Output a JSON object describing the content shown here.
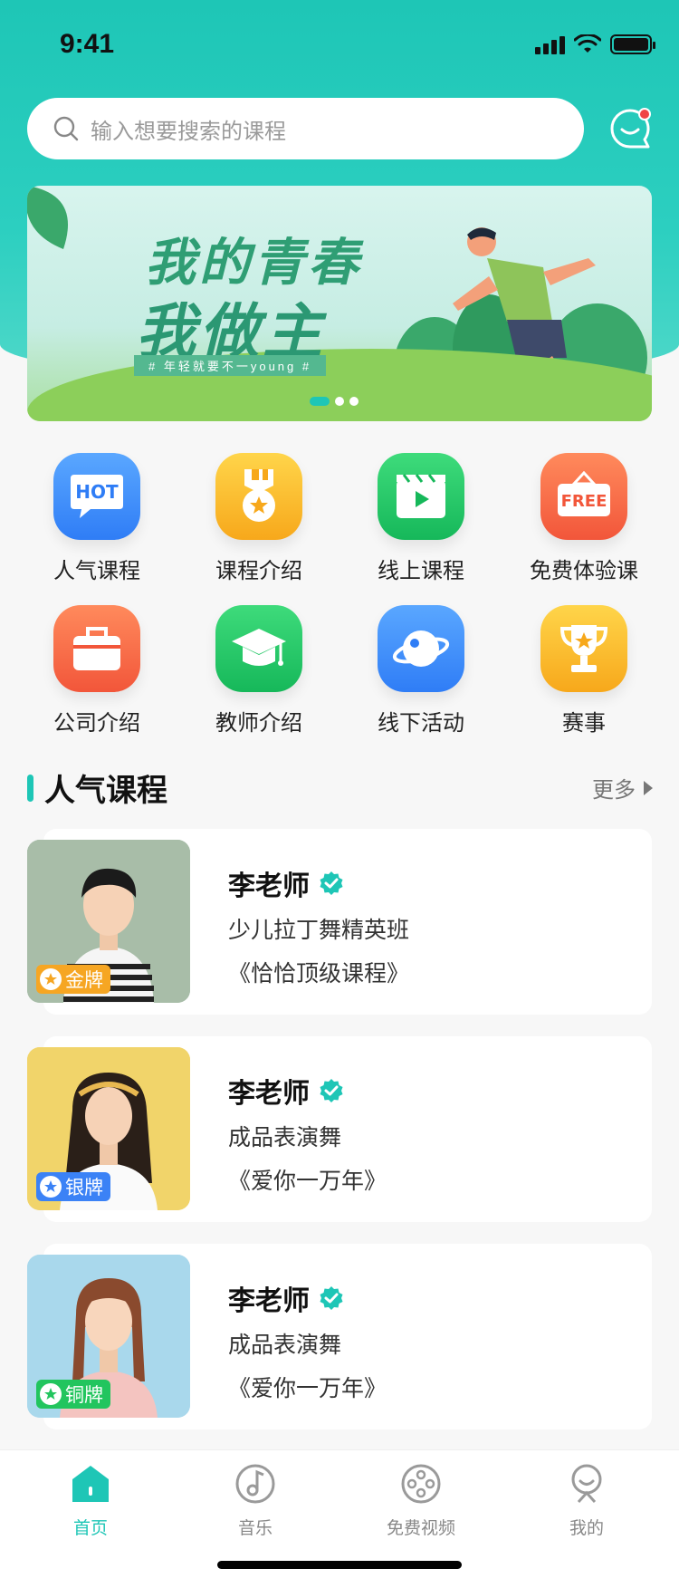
{
  "status": {
    "time": "9:41"
  },
  "search": {
    "placeholder": "输入想要搜索的课程"
  },
  "banner": {
    "title_line1": "我的青春",
    "title_line2": "我做主",
    "subtitle": "# 年轻就要不一young #",
    "slides": 3,
    "active_slide": 1
  },
  "categories": [
    {
      "label": "人气课程",
      "icon": "hot-icon"
    },
    {
      "label": "课程介绍",
      "icon": "medal-icon"
    },
    {
      "label": "线上课程",
      "icon": "video-icon"
    },
    {
      "label": "免费体验课",
      "icon": "free-icon"
    },
    {
      "label": "公司介绍",
      "icon": "briefcase-icon"
    },
    {
      "label": "教师介绍",
      "icon": "graduation-cap-icon"
    },
    {
      "label": "线下活动",
      "icon": "planet-icon"
    },
    {
      "label": "赛事",
      "icon": "trophy-icon"
    }
  ],
  "section": {
    "title": "人气课程",
    "more": "更多"
  },
  "courses": [
    {
      "teacher": "李老师",
      "course": "少儿拉丁舞精英班",
      "work": "《恰恰顶级课程》",
      "medal": "金牌",
      "medal_color": "#f6a623"
    },
    {
      "teacher": "李老师",
      "course": "成品表演舞",
      "work": "《爱你一万年》",
      "medal": "银牌",
      "medal_color": "#3b82f6"
    },
    {
      "teacher": "李老师",
      "course": "成品表演舞",
      "work": "《爱你一万年》",
      "medal": "铜牌",
      "medal_color": "#22c55e"
    }
  ],
  "tabs": [
    {
      "label": "首页",
      "icon": "home-icon",
      "active": true
    },
    {
      "label": "音乐",
      "icon": "music-icon",
      "active": false
    },
    {
      "label": "免费视频",
      "icon": "film-reel-icon",
      "active": false
    },
    {
      "label": "我的",
      "icon": "profile-icon",
      "active": false
    }
  ],
  "colors": {
    "accent": "#1ec6b6"
  }
}
